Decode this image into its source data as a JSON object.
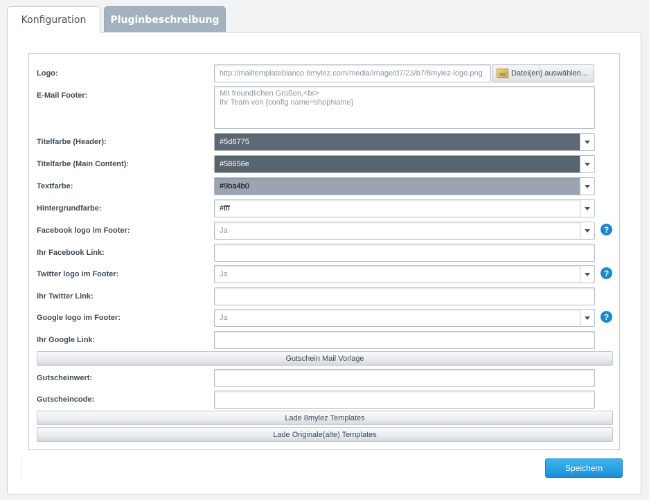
{
  "tabs": [
    {
      "label": "Konfiguration",
      "active": true
    },
    {
      "label": "Pluginbeschreibung",
      "active": false
    }
  ],
  "form": {
    "logo": {
      "label": "Logo:",
      "value": "http://mailtemplatebianco.8mylez.com/media/image/d7/23/b7/8mylez-logo.png",
      "button": "Datei(en) auswählen..."
    },
    "email_footer": {
      "label": "E-Mail Footer:",
      "value": "Mit freundlichen Grüßen,<br>\nIhr Team von {config name=shopName}"
    },
    "title_color_header": {
      "label": "Titelfarbe (Header):",
      "value": "#5d6775",
      "color": "#5d6775",
      "text_color": "#ffffff"
    },
    "title_color_main": {
      "label": "Titelfarbe (Main Content):",
      "value": "#58656e",
      "color": "#58656e",
      "text_color": "#ffffff"
    },
    "text_color": {
      "label": "Textfarbe:",
      "value": "#9ba4b0",
      "color": "#9ba4b0",
      "text_color": "#000000"
    },
    "background_color": {
      "label": "Hintergrundfarbe:",
      "value": "#fff",
      "color": "#ffffff",
      "text_color": "#000000"
    },
    "facebook_logo": {
      "label": "Facebook logo im Footer:",
      "value": "Ja"
    },
    "facebook_link": {
      "label": "Ihr Facebook Link:",
      "value": ""
    },
    "twitter_logo": {
      "label": "Twitter logo im Footer:",
      "value": "Ja"
    },
    "twitter_link": {
      "label": "Ihr Twitter Link:",
      "value": ""
    },
    "google_logo": {
      "label": "Google logo im Footer:",
      "value": "Ja"
    },
    "google_link": {
      "label": "Ihr Google Link:",
      "value": ""
    },
    "voucher_section": "Gutschein Mail Vorlage",
    "voucher_value": {
      "label": "Gutscheinwert:",
      "value": ""
    },
    "voucher_code": {
      "label": "Gutscheincode:",
      "value": ""
    },
    "load_8mylez": "Lade 8mylez Templates",
    "load_original": "Lade Originale(alte) Templates"
  },
  "help_icon": "?",
  "save_label": "Speichern"
}
